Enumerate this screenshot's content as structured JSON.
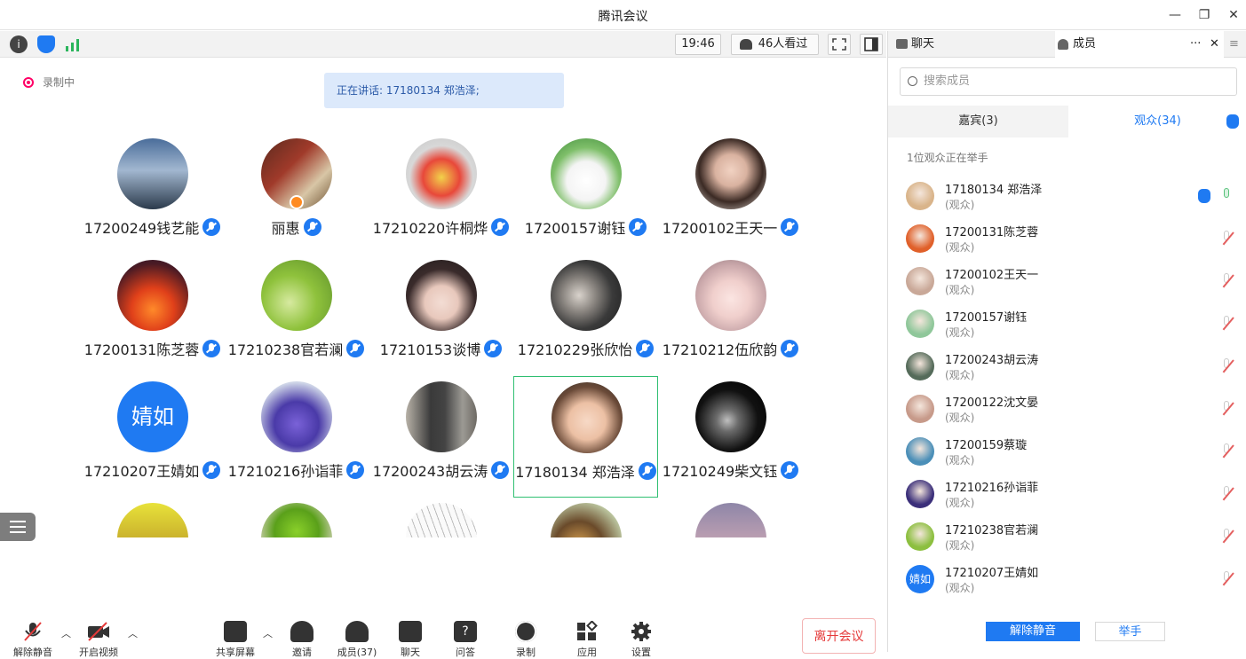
{
  "window": {
    "title": "腾讯会议"
  },
  "toolbar": {
    "time": "19:46",
    "viewers": "46人看过"
  },
  "main": {
    "recording_label": "录制中",
    "speaking_label": "正在讲话: 17180134 郑浩泽;",
    "participants": [
      {
        "name": "17200249钱艺能"
      },
      {
        "name": "丽惠"
      },
      {
        "name": "17210220许桐烨"
      },
      {
        "name": "17200157谢钰"
      },
      {
        "name": "17200102王天一"
      },
      {
        "name": "17200131陈芝蓉"
      },
      {
        "name": "17210238官若澜"
      },
      {
        "name": "17210153谈博"
      },
      {
        "name": "17210229张欣怡"
      },
      {
        "name": "17210212伍欣韵"
      },
      {
        "name": "17210207王婧如",
        "avatar_text": "婧如"
      },
      {
        "name": "17210216孙诣菲"
      },
      {
        "name": "17200243胡云涛"
      },
      {
        "name": "17180134 郑浩泽"
      },
      {
        "name": "17210249柴文钰"
      }
    ]
  },
  "bottombar": {
    "items": [
      {
        "label": "解除静音"
      },
      {
        "label": "开启视频"
      },
      {
        "label": "共享屏幕"
      },
      {
        "label": "邀请"
      },
      {
        "label": "成员(37)"
      },
      {
        "label": "聊天"
      },
      {
        "label": "问答"
      },
      {
        "label": "录制"
      },
      {
        "label": "应用"
      },
      {
        "label": "设置"
      }
    ],
    "leave_label": "离开会议"
  },
  "panel": {
    "tabs": {
      "chat": "聊天",
      "members": "成员"
    },
    "search_placeholder": "搜索成员",
    "segment": {
      "guests": "嘉宾(3)",
      "audience": "观众(34)"
    },
    "hand_notice": "1位观众正在举手",
    "members": [
      {
        "name": "17180134 郑浩泽",
        "role": "(观众)",
        "color": "#d9b48a"
      },
      {
        "name": "17200131陈芝蓉",
        "role": "(观众)",
        "color": "#e0602a"
      },
      {
        "name": "17200102王天一",
        "role": "(观众)",
        "color": "#c9a898"
      },
      {
        "name": "17200157谢钰",
        "role": "(观众)",
        "color": "#8fc79a"
      },
      {
        "name": "17200243胡云涛",
        "role": "(观众)",
        "color": "#556b5a"
      },
      {
        "name": "17200122沈文晏",
        "role": "(观众)",
        "color": "#c79a8a"
      },
      {
        "name": "17200159蔡璇",
        "role": "(观众)",
        "color": "#4b8fb8"
      },
      {
        "name": "17210216孙诣菲",
        "role": "(观众)",
        "color": "#3b2f7a"
      },
      {
        "name": "17210238官若澜",
        "role": "(观众)",
        "color": "#8cbf3f"
      },
      {
        "name": "17210207王婧如",
        "role": "(观众)",
        "avatar_text": "婧如"
      }
    ],
    "unmute_label": "解除静音",
    "raise_hand_label": "举手"
  },
  "colors": {
    "accent": "#1f7af2",
    "active_border": "#2fbf71",
    "leave": "#e53a3a"
  }
}
